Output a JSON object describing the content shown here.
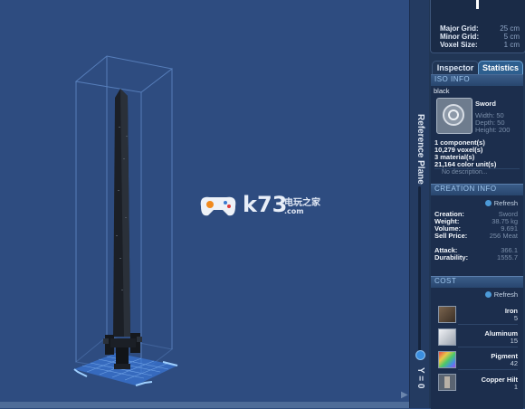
{
  "grid": {
    "rows": [
      {
        "label": "Major Grid:",
        "value": "25 cm"
      },
      {
        "label": "Minor Grid:",
        "value": "5 cm"
      },
      {
        "label": "Voxel Size:",
        "value": "1 cm"
      }
    ]
  },
  "tabs": {
    "inspector": "Inspector",
    "statistics": "Statistics"
  },
  "viewport": {
    "reference_plane_label": "Reference Plane",
    "y_label": "Y = 0"
  },
  "iso_info": {
    "header": "ISO INFO",
    "name": "black",
    "item_title": "Sword",
    "width": "Width: 50",
    "depth": "Depth: 50",
    "height": "Height: 200",
    "components": "1 component(s)",
    "voxels": "10,279 voxel(s)",
    "materials": "3 material(s)",
    "color_units": "21,164 color unit(s)",
    "description": "No description..."
  },
  "creation_info": {
    "header": "CREATION INFO",
    "refresh": "Refresh",
    "rows": [
      {
        "label": "Creation:",
        "value": "Sword"
      },
      {
        "label": "Weight:",
        "value": "38.75 kg"
      },
      {
        "label": "Volume:",
        "value": "9.691"
      },
      {
        "label": "Sell Price:",
        "value": "256 Meat"
      }
    ],
    "attack": {
      "label": "Attack:",
      "value": "366.1"
    },
    "durability": {
      "label": "Durability:",
      "value": "1555.7"
    }
  },
  "cost": {
    "header": "COST",
    "refresh": "Refresh",
    "items": [
      {
        "name": "Iron",
        "amount": "5",
        "icon": "iron-block-icon",
        "color": "#5b4a3a"
      },
      {
        "name": "Aluminum",
        "amount": "15",
        "icon": "aluminum-block-icon",
        "color": "#c9ced6"
      },
      {
        "name": "Pigment",
        "amount": "42",
        "icon": "pigment-icon",
        "color": "#5aa8d8"
      },
      {
        "name": "Copper Hilt",
        "amount": "1",
        "icon": "copper-hilt-icon",
        "color": "#8a7a6a"
      }
    ]
  },
  "watermark": {
    "main": "k73",
    "sub": "电玩之家",
    "com": ".com"
  }
}
